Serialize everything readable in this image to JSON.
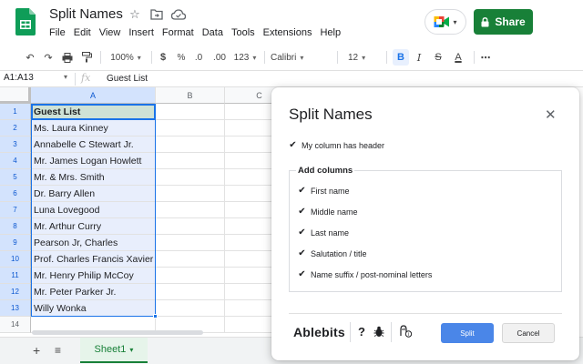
{
  "app": {
    "doc_title": "Split Names",
    "menu": [
      "File",
      "Edit",
      "View",
      "Insert",
      "Format",
      "Data",
      "Tools",
      "Extensions",
      "Help"
    ],
    "share_label": "Share"
  },
  "toolbar": {
    "zoom": "100%",
    "currency": "$",
    "percent": "%",
    "dec_decrease": ".0",
    "dec_increase": ".00",
    "more_formats": "123",
    "font": "Calibri",
    "font_size": "12",
    "bold": "B",
    "italic": "I",
    "strike": "S",
    "text_color": "A",
    "more": "⋯"
  },
  "formula_bar": {
    "name_box": "A1:A13",
    "fx": "fx",
    "value": "Guest List"
  },
  "grid": {
    "columns": [
      "A",
      "B",
      "C"
    ],
    "rows": [
      "1",
      "2",
      "3",
      "4",
      "5",
      "6",
      "7",
      "8",
      "9",
      "10",
      "11",
      "12",
      "13",
      "14"
    ],
    "column_a": [
      "Guest List",
      "Ms. Laura Kinney",
      "Annabelle C Stewart Jr.",
      "Mr. James Logan Howlett",
      "Mr. & Mrs. Smith",
      "Dr. Barry Allen",
      "Luna Lovegood",
      "Mr. Arthur Curry",
      "Pearson Jr, Charles",
      "Prof. Charles Francis Xavier",
      "Mr. Henry Philip McCoy",
      "Mr. Peter Parker Jr.",
      "Willy Wonka",
      ""
    ]
  },
  "sheets": {
    "active": "Sheet1"
  },
  "dialog": {
    "title": "Split Names",
    "header_option": "My column has header",
    "group_title": "Add columns",
    "columns": [
      "First name",
      "Middle name",
      "Last name",
      "Salutation / title",
      "Name suffix / post-nominal letters"
    ],
    "brand": "Ablebits",
    "split_label": "Split",
    "cancel_label": "Cancel"
  },
  "colors": {
    "share_green": "#188038",
    "selection_blue": "#1a73e8",
    "header_cell_green": "#cfe2d6",
    "split_button": "#4a86e8"
  }
}
